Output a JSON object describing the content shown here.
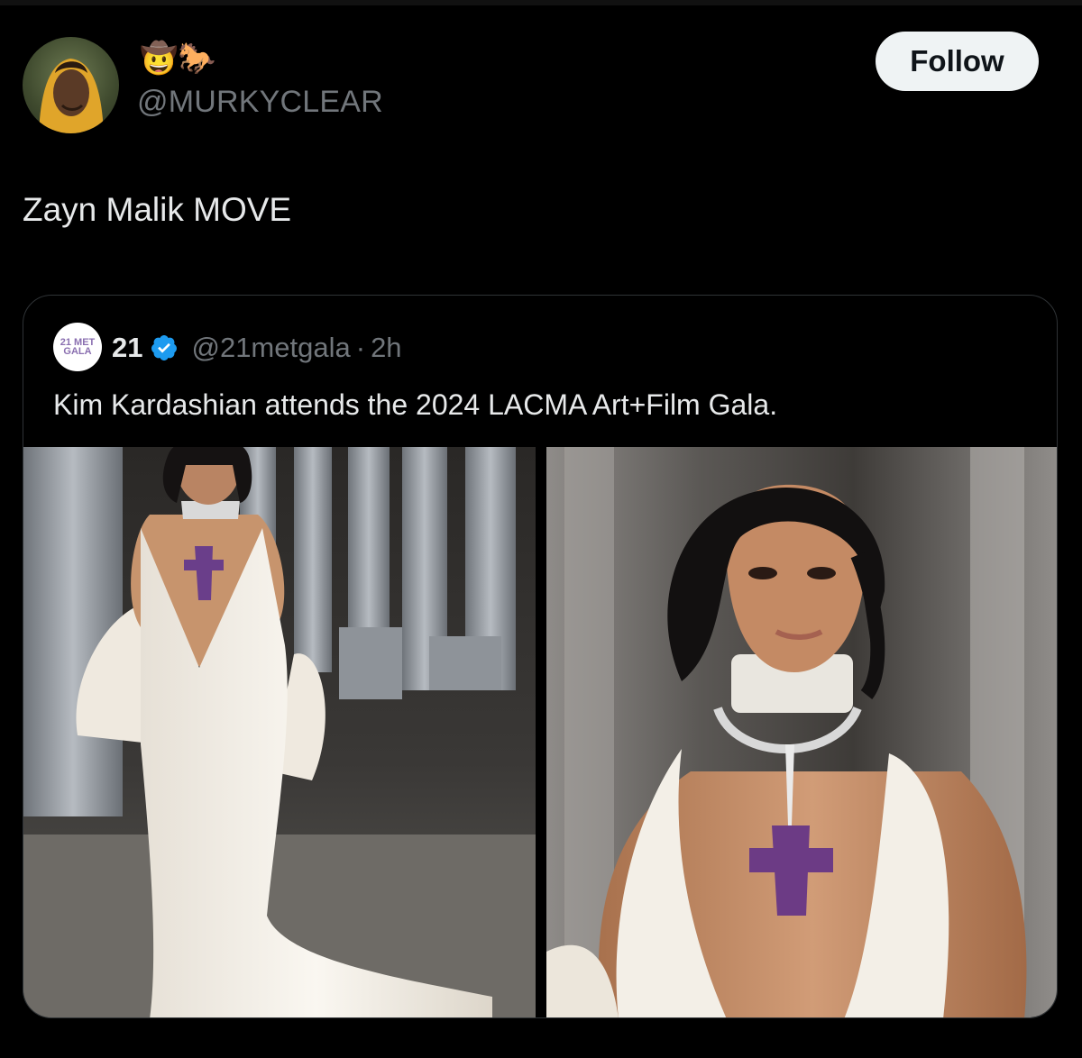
{
  "post": {
    "author_emojis": "🤠🐎",
    "author_handle": "@MURKYCLEAR",
    "follow_label": "Follow",
    "text": "Zayn Malik MOVE"
  },
  "quoted_post": {
    "avatar_text": "21 MET GALA",
    "author_name": "21",
    "author_handle": "@21metgala",
    "separator": "·",
    "time": "2h",
    "text": "Kim Kardashian attends the 2024 LACMA Art+Film Gala.",
    "media": [
      {
        "name": "photo-full-length"
      },
      {
        "name": "photo-close-up"
      }
    ]
  },
  "colors": {
    "background": "#000000",
    "text_primary": "#e7e9ea",
    "text_secondary": "#71767b",
    "verified_blue": "#1d9bf0",
    "follow_bg": "#eff3f4"
  },
  "icons": {
    "verified": "verified-badge-icon"
  }
}
